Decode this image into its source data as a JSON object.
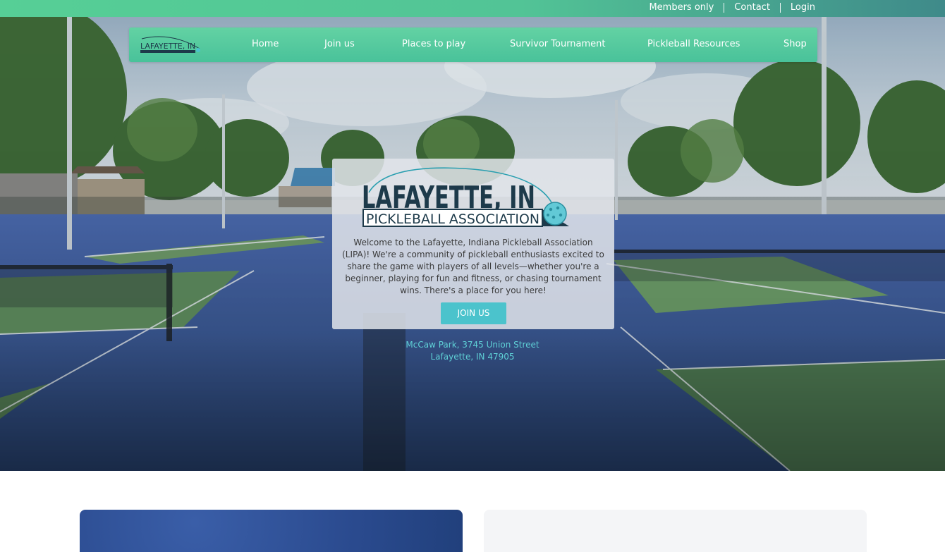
{
  "topbar": {
    "links": [
      "Members only",
      "Contact",
      "Login"
    ]
  },
  "nav": {
    "logo_text": "LAFAYETTE, IN",
    "items": [
      "Home",
      "Join us",
      "Places to play",
      "Survivor Tournament",
      "Pickleball Resources",
      "Shop"
    ]
  },
  "hero": {
    "logo_line1": "LAFAYETTE, IN",
    "logo_line2": "PICKLEBALL ASSOCIATION",
    "welcome_text": "Welcome to the Lafayette, Indiana Pickleball Association (LIPA)! We're a community of pickleball enthusiasts excited to share the game with players of all levels—whether you're a beginner, playing for fun and fitness, or chasing tournament wins. There's a place for you here!",
    "join_button": "JOIN US",
    "address_line1": "McCaw Park, 3745 Union Street",
    "address_line2": "Lafayette, IN 47905"
  },
  "colors": {
    "brand_green": "#52c99a",
    "accent_teal": "#4bc3cc",
    "logo_navy": "#1d3a4a"
  }
}
